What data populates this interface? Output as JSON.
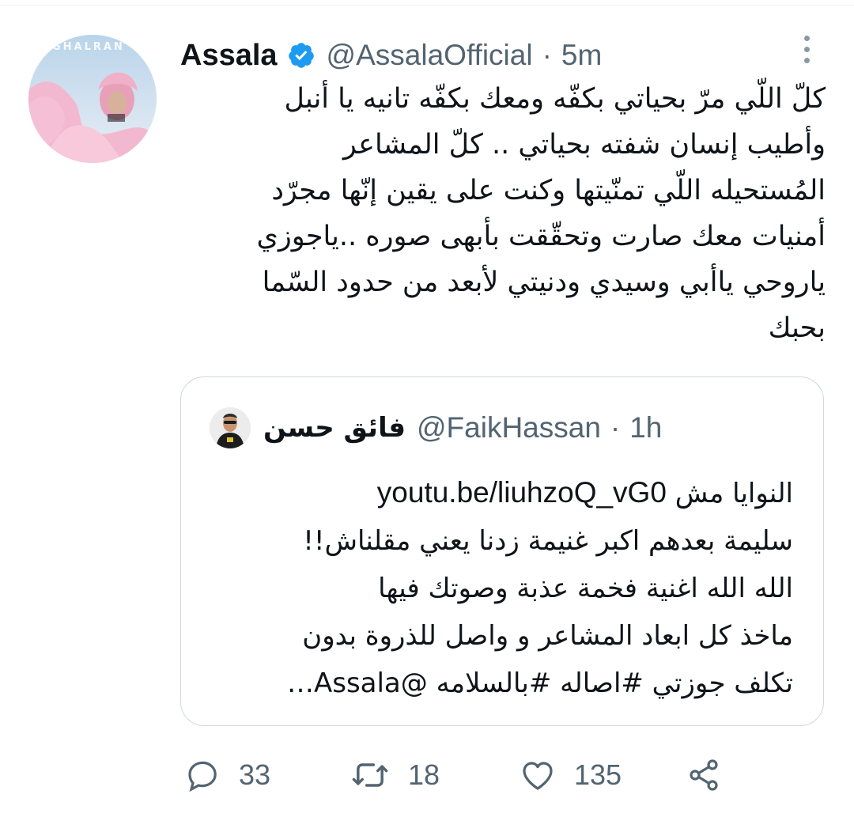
{
  "tweet": {
    "author_name": "Assala",
    "author_handle": "@AssalaOfficial",
    "time": "5m",
    "separator": "·",
    "avatar_label": "GHALRAN",
    "text": "كلّ اللّي مرّ بحياتي بكفّه ومعك بكفّه تانيه يا أنبل\nوأطيب إنسان شفته بحياتي .. كلّ المشاعر\nالمُستحيله اللّي تمنّيتها وكنت على يقين إنّها مجرّد\nأمنيات معك صارت وتحقّقت بأبهى صوره ..ياجوزي\nياروحي ياأبي وسيدي ودنيتي لأبعد من حدود السّما\nبحبك"
  },
  "quoted": {
    "author_name": "فائق حسن",
    "author_handle": "@FaikHassan",
    "time": "1h",
    "separator": "·",
    "link": "youtu.be/liuhzoQ_vG0",
    "line1_tail": "النوايا مش",
    "rest": "سليمة بعدهم اكبر غنيمة زدنا يعني مقلناش!!\nالله الله اغنية فخمة عذبة وصوتك فيها\nماخذ كل ابعاد المشاعر و واصل للذروة بدون\nتكلف جوزتي #اصاله #بالسلامه   @Assala…"
  },
  "actions": {
    "replies": "33",
    "retweets": "18",
    "likes": "135"
  },
  "icons": {
    "verified": "verified-badge-icon",
    "more": "more-options-icon",
    "reply": "reply-icon",
    "retweet": "retweet-icon",
    "like": "heart-icon",
    "share": "share-icon"
  },
  "colors": {
    "text": "#0f1419",
    "secondary": "#536471",
    "verified": "#1d9bf0",
    "border": "#cfd9de"
  }
}
